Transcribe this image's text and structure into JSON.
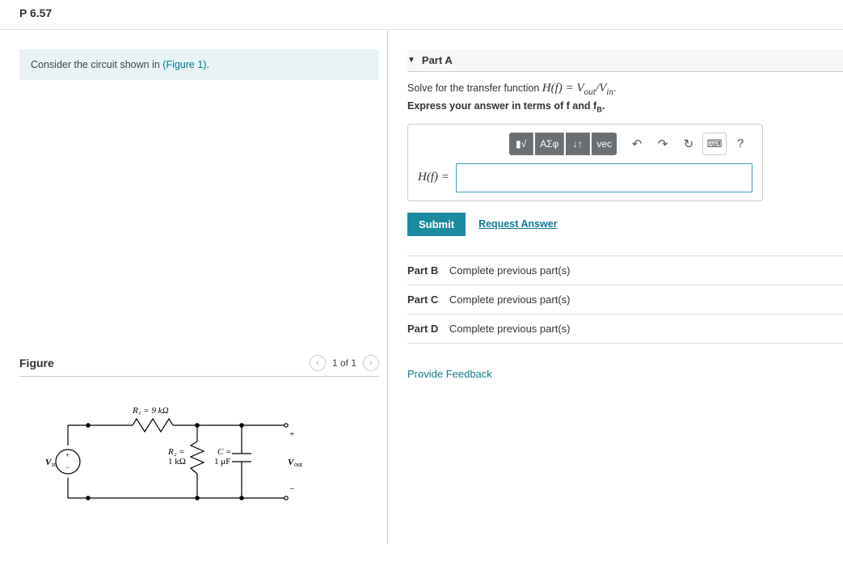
{
  "problem_id": "P 6.57",
  "instructions": {
    "prefix": "Consider the circuit shown in ",
    "link_text": "(Figure 1)",
    "suffix": "."
  },
  "figure": {
    "title": "Figure",
    "nav_text": "1 of 1",
    "components": {
      "r1_label": "R₁ = 9 kΩ",
      "r2_label_top": "R₂ =",
      "r2_label_bot": "1 kΩ",
      "c_label_top": "C =",
      "c_label_bot": "1 μF",
      "vin": "Vin",
      "vout": "Vout",
      "plus": "+",
      "minus": "−",
      "src_plus": "+",
      "src_minus": "−"
    }
  },
  "partA": {
    "label": "Part A",
    "question_prefix": "Solve for the transfer function  ",
    "question_eq": "H(f) = V",
    "question_sub1": "out",
    "question_mid": "/V",
    "question_sub2": "in",
    "question_suffix": ".",
    "hint_prefix": "Express your answer in terms of ",
    "hint_f": "f",
    "hint_and": " and ",
    "hint_fb": "f",
    "hint_fb_sub": "B",
    "hint_suffix": ".",
    "toolbar": {
      "templates": "▮√",
      "greek": "ΑΣφ",
      "updown": "↓↑",
      "vec": "vec",
      "undo": "↶",
      "redo": "↷",
      "reset": "↻",
      "keyboard": "⌨",
      "help": "?"
    },
    "lhs": "H(f) =",
    "submit": "Submit",
    "request": "Request Answer"
  },
  "parts_locked": [
    {
      "label": "Part B",
      "msg": "Complete previous part(s)"
    },
    {
      "label": "Part C",
      "msg": "Complete previous part(s)"
    },
    {
      "label": "Part D",
      "msg": "Complete previous part(s)"
    }
  ],
  "feedback": "Provide Feedback"
}
